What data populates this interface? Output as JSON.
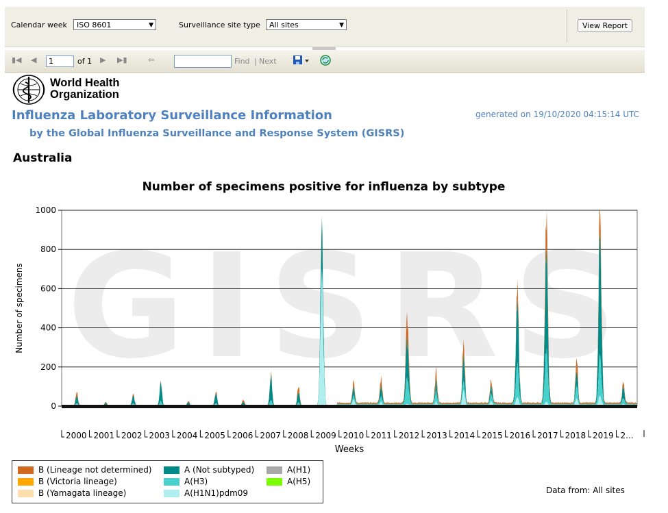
{
  "params": {
    "week_label": "Calendar week",
    "week_value": "ISO 8601",
    "site_label": "Surveillance site type",
    "site_value": "All sites",
    "view_button": "View Report"
  },
  "toolbar": {
    "page_value": "1",
    "of_label": "of 1",
    "find_label": "Find",
    "separator": "|",
    "next_label": "Next"
  },
  "report": {
    "logo_line1": "World Health",
    "logo_line2": "Organization",
    "title": "Influenza Laboratory Surveillance Information",
    "subtitle": "by the Global Influenza Surveillance and Response System (GISRS)",
    "generated": "generated on 19/10/2020 04:15:14 UTC",
    "country": "Australia",
    "data_from": "Data from: All sites"
  },
  "colors": {
    "b_lineage_not_determined": "#d2691e",
    "b_victoria": "#ffa500",
    "b_yamagata": "#ffdead",
    "a_not_subtyped": "#008b8b",
    "a_h3": "#48d1cc",
    "a_h1n1pdm09": "#afeeee",
    "a_h1": "#a9a9a9",
    "a_h5": "#7cfc00",
    "title_blue": "#4f81bd"
  },
  "chart_data": {
    "type": "area",
    "title": "Number of specimens positive for influenza by subtype",
    "xlabel": "Weeks",
    "ylabel": "Number of specimens",
    "ylim": [
      0,
      1000
    ],
    "yticks": [
      0,
      200,
      400,
      600,
      800,
      1000
    ],
    "grid": true,
    "watermark": "GISRS",
    "x_labels": [
      "2000",
      "2001",
      "2002",
      "2003",
      "2004",
      "2005",
      "2006",
      "2007",
      "2008",
      "2009",
      "2010",
      "2011",
      "2012",
      "2013",
      "2014",
      "2015",
      "2016",
      "2017",
      "2018",
      "2019",
      "2..."
    ],
    "legend_position": "bottom-left",
    "series": [
      {
        "name": "B (Lineage not determined)",
        "color": "#d2691e"
      },
      {
        "name": "B (Victoria lineage)",
        "color": "#ffa500"
      },
      {
        "name": "B (Yamagata lineage)",
        "color": "#ffdead"
      },
      {
        "name": "A (Not subtyped)",
        "color": "#008b8b"
      },
      {
        "name": "A(H3)",
        "color": "#48d1cc"
      },
      {
        "name": "A(H1N1)pdm09",
        "color": "#afeeee"
      },
      {
        "name": "A(H1)",
        "color": "#a9a9a9"
      },
      {
        "name": "A(H5)",
        "color": "#7cfc00"
      }
    ],
    "seasonal_peaks": [
      {
        "year": 2000.55,
        "total": 70,
        "a_ns": 35,
        "h3": 15,
        "pdm": 0
      },
      {
        "year": 2001.6,
        "total": 20,
        "a_ns": 10,
        "h3": 5,
        "pdm": 0
      },
      {
        "year": 2002.6,
        "total": 65,
        "a_ns": 40,
        "h3": 15,
        "pdm": 0
      },
      {
        "year": 2003.6,
        "total": 120,
        "a_ns": 90,
        "h3": 25,
        "pdm": 0
      },
      {
        "year": 2004.6,
        "total": 25,
        "a_ns": 15,
        "h3": 5,
        "pdm": 0
      },
      {
        "year": 2005.6,
        "total": 75,
        "a_ns": 50,
        "h3": 15,
        "pdm": 0
      },
      {
        "year": 2006.6,
        "total": 30,
        "a_ns": 15,
        "h3": 5,
        "pdm": 0
      },
      {
        "year": 2007.6,
        "total": 165,
        "a_ns": 120,
        "h3": 30,
        "pdm": 0
      },
      {
        "year": 2008.6,
        "total": 100,
        "a_ns": 50,
        "h3": 20,
        "pdm": 0
      },
      {
        "year": 2009.45,
        "total": 845,
        "a_ns": 230,
        "h3": 10,
        "pdm": 600
      },
      {
        "year": 2010.6,
        "total": 105,
        "a_ns": 40,
        "h3": 10,
        "pdm": 30
      },
      {
        "year": 2011.6,
        "total": 130,
        "a_ns": 55,
        "h3": 20,
        "pdm": 20
      },
      {
        "year": 2012.55,
        "total": 440,
        "a_ns": 200,
        "h3": 120,
        "pdm": 10
      },
      {
        "year": 2013.6,
        "total": 160,
        "a_ns": 50,
        "h3": 40,
        "pdm": 20
      },
      {
        "year": 2014.6,
        "total": 320,
        "a_ns": 130,
        "h3": 40,
        "pdm": 80
      },
      {
        "year": 2015.6,
        "total": 120,
        "a_ns": 40,
        "h3": 30,
        "pdm": 25
      },
      {
        "year": 2016.55,
        "total": 560,
        "a_ns": 300,
        "h3": 150,
        "pdm": 40
      },
      {
        "year": 2017.6,
        "total": 945,
        "a_ns": 500,
        "h3": 250,
        "pdm": 20
      },
      {
        "year": 2018.7,
        "total": 245,
        "a_ns": 80,
        "h3": 60,
        "pdm": 40
      },
      {
        "year": 2019.55,
        "total": 995,
        "a_ns": 600,
        "h3": 200,
        "pdm": 50
      },
      {
        "year": 2020.4,
        "total": 110,
        "a_ns": 60,
        "h3": 20,
        "pdm": 10
      }
    ]
  }
}
